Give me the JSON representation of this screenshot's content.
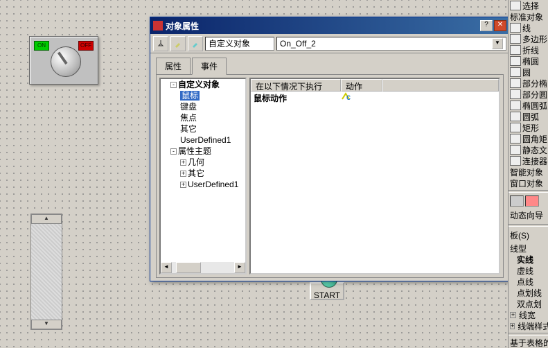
{
  "dialog": {
    "title": "对象属性",
    "object_type_label": "自定义对象",
    "object_name": "On_Off_2",
    "tabs": {
      "attr": "属性",
      "event": "事件"
    },
    "tree": {
      "root": "自定义对象",
      "mouse": "鼠标",
      "keyboard": "键盘",
      "focus": "焦点",
      "other": "其它",
      "ud1": "UserDefined1",
      "topic": "属性主题",
      "geom": "几何",
      "other2": "其它",
      "ud2": "UserDefined1"
    },
    "list": {
      "col_exec": "在以下情况下执行",
      "col_action": "动作",
      "row1_exec": "鼠标动作"
    }
  },
  "dial": {
    "on": "ON",
    "off": "OFF"
  },
  "start": {
    "label": "START"
  },
  "rpanel": {
    "select": "选择",
    "stdobj": "标准对象",
    "line": "线",
    "poly": "多边形",
    "polyline": "折线",
    "ellipse": "椭圆",
    "circle": "圆",
    "partell": "部分椭",
    "pie": "部分圆",
    "ellarc": "椭圆弧",
    "arc": "圆弧",
    "rect": "矩形",
    "rrect": "圆角矩",
    "stext": "静态文",
    "conn": "连接器",
    "smart": "智能对象",
    "winobj": "窗口对象",
    "dynguide": "动态向导",
    "style_hdr": "板(S)",
    "linetype": "线型",
    "solid": "实线",
    "dash": "虚线",
    "dot": "点线",
    "dashdot": "点划线",
    "dashdotdot": "双点划",
    "lw": "线宽",
    "lineend": "线端样式",
    "note": "基于表格的"
  }
}
